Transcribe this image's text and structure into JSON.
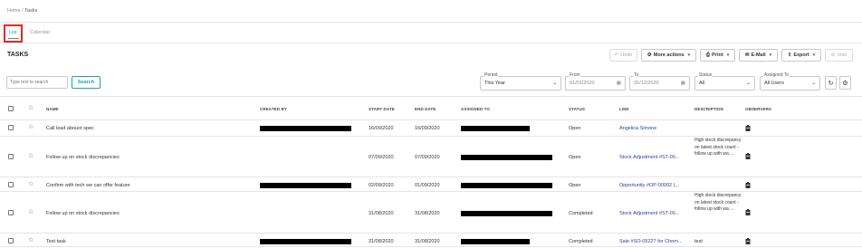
{
  "breadcrumb": {
    "home": "Home",
    "sep": "/",
    "current": "Tasks"
  },
  "view_tabs": [
    {
      "label": "List",
      "active": true
    },
    {
      "label": "Calendar",
      "active": false
    }
  ],
  "page_title": "TASKS",
  "toolbar": {
    "undo": "Undo",
    "more_actions": "More actions",
    "print": "Print",
    "email": "E-Mail",
    "export": "Export",
    "void": "Void"
  },
  "filters": {
    "search_placeholder": "Type text to search",
    "search_button": "Search",
    "period": {
      "label": "Period",
      "value": "This Year"
    },
    "from": {
      "label": "From",
      "value": "01/01/2020"
    },
    "to": {
      "label": "To",
      "value": "31/12/2020"
    },
    "status": {
      "label": "Status",
      "value": "All"
    },
    "assigned_to": {
      "label": "Assigned To",
      "value": "All Users"
    }
  },
  "table": {
    "columns": [
      "NAME",
      "CREATED BY",
      "START DATE",
      "END DATE",
      "ASSIGNED TO",
      "STATUS",
      "LINK",
      "DESCRIPTION",
      "OBSERVERS"
    ],
    "rows": [
      {
        "name": "Call lead abouot spec",
        "start": "16/09/2020",
        "end": "16/09/2020",
        "status": "Open",
        "link": "Angelica Simone",
        "description": ""
      },
      {
        "name": "Follow up on stock discrepancies",
        "start": "07/09/2020",
        "end": "07/09/2020",
        "status": "Open",
        "link": "Stock Adjustment #ST-00...",
        "description": "High stock discrepancy on latest stock count - follow up with wa ..."
      },
      {
        "name": "Confirm with tech we can offer feature",
        "start": "02/09/2020",
        "end": "01/09/2020",
        "status": "Open",
        "link": "Opportunity #OP-00002 (...",
        "description": ""
      },
      {
        "name": "Follow up on stock discrepancies",
        "start": "31/08/2020",
        "end": "31/08/2020",
        "status": "Completed",
        "link": "Stock Adjustment #ST-00...",
        "description": "High stock discrepancy on latest stock count - follow up with wa ..."
      },
      {
        "name": "Test task",
        "start": "31/08/2020",
        "end": "31/08/2020",
        "status": "Completed",
        "link": "Sale #SO-05227 for Chom...",
        "description": "test"
      }
    ]
  },
  "colors": {
    "accent": "#1aa8a8",
    "highlight": "#e8291c",
    "link": "#2a3fa6"
  }
}
